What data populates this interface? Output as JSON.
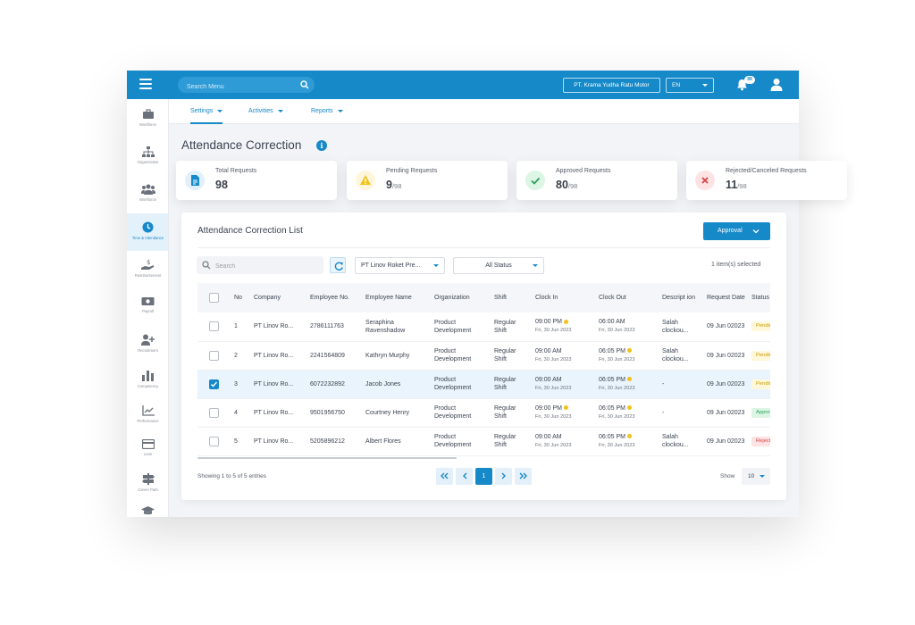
{
  "topbar": {
    "search_placeholder": "Search Menu",
    "company": "PT. Krama Yudha Ratu Motor",
    "language": "EN",
    "notification_count": "99"
  },
  "sidebar": {
    "items": [
      {
        "label": "Workforce",
        "icon": "briefcase-icon"
      },
      {
        "label": "Organization",
        "icon": "org-chart-icon"
      },
      {
        "label": "Workforce",
        "icon": "people-icon"
      },
      {
        "label": "Time & Attendance",
        "icon": "clock-icon"
      },
      {
        "label": "Reimbursement",
        "icon": "hand-dollar-icon"
      },
      {
        "label": "Payroll",
        "icon": "money-icon"
      },
      {
        "label": "Recruitment",
        "icon": "add-user-icon"
      },
      {
        "label": "Competency",
        "icon": "bar-chart-icon"
      },
      {
        "label": "Performance",
        "icon": "trend-chart-icon"
      },
      {
        "label": "Loan",
        "icon": "card-icon"
      },
      {
        "label": "Career Path",
        "icon": "signpost-icon"
      },
      {
        "label": "",
        "icon": "graduation-cap-icon"
      }
    ]
  },
  "subnav": {
    "settings": "Settings",
    "activities": "Activities",
    "reports": "Reports"
  },
  "page": {
    "title": "Attendance Correction"
  },
  "cards": {
    "total": {
      "title": "Total Requests",
      "value": "98"
    },
    "pending": {
      "title": "Pending Requests",
      "value": "9",
      "total": "/98"
    },
    "approved": {
      "title": "Approved Requests",
      "value": "80",
      "total": "/98"
    },
    "rejected": {
      "title": "Rejected/Canceled Requests",
      "value": "11",
      "total": "/98"
    }
  },
  "list": {
    "title": "Attendance Correction List",
    "approval_button": "Approval",
    "search_placeholder": "Search",
    "company_filter": "PT Linov Roket Pre...",
    "status_filter": "All Status",
    "selected_text": "1 item(s) selected"
  },
  "table": {
    "headers": {
      "no": "No",
      "company": "Company",
      "employee_no": "Employee No.",
      "employee_name": "Employee Name",
      "organization": "Organization",
      "shift": "Shift",
      "clock_in": "Clock In",
      "clock_out": "Clock Out",
      "description": "Descript ion",
      "request_date": "Request Date",
      "status": "Status"
    },
    "rows": [
      {
        "no": "1",
        "company": "PT Linov Ro...",
        "employee_no": "2786111763",
        "name": "Seraphina Ravenshadow",
        "org": "Product Development",
        "shift": "Regular Shift",
        "in_time": "09:00 PM",
        "in_date": "Fri, 30 Jun 2023",
        "out_time": "06:00 AM",
        "out_date": "Fri, 30 Jun 2023",
        "desc": "Salah clockou...",
        "req_date": "09 Jun 02023",
        "status": "Pending",
        "checked": false
      },
      {
        "no": "2",
        "company": "PT Linov Ro...",
        "employee_no": "2241564809",
        "name": "Kathryn Murphy",
        "org": "Product Development",
        "shift": "Regular Shift",
        "in_time": "09:00 AM",
        "in_date": "Fri, 30 Jun 2023",
        "out_time": "06:05 PM",
        "out_date": "Fri, 30 Jun 2023",
        "desc": "Salah clockou...",
        "req_date": "09 Jun 02023",
        "status": "Pending",
        "checked": false
      },
      {
        "no": "3",
        "company": "PT Linov Ro...",
        "employee_no": "6072232892",
        "name": "Jacob Jones",
        "org": "Product Development",
        "shift": "Regular Shift",
        "in_time": "09:00 AM",
        "in_date": "Fri, 30 Jun 2023",
        "out_time": "06:05 PM",
        "out_date": "Fri, 30 Jun 2023",
        "desc": "-",
        "req_date": "09 Jun 02023",
        "status": "Pending",
        "checked": true
      },
      {
        "no": "4",
        "company": "PT Linov Ro...",
        "employee_no": "9501956750",
        "name": "Courtney Henry",
        "org": "Product Development",
        "shift": "Regular Shift",
        "in_time": "09:00 PM",
        "in_date": "Fri, 30 Jun 2023",
        "out_time": "06:05 PM",
        "out_date": "Fri, 30 Jun 2023",
        "desc": "-",
        "req_date": "09 Jun 02023",
        "status": "Approved",
        "checked": false
      },
      {
        "no": "5",
        "company": "PT Linov Ro...",
        "employee_no": "5205896212",
        "name": "Albert Flores",
        "org": "Product Development",
        "shift": "Regular Shift",
        "in_time": "09:00 AM",
        "in_date": "Fri, 30 Jun 2023",
        "out_time": "06:05 PM",
        "out_date": "Fri, 30 Jun 2023",
        "desc": "Salah clockou...",
        "req_date": "09 Jun 02023",
        "status": "Rejected",
        "checked": false
      }
    ]
  },
  "footer": {
    "showing": "Showing 1 to 5 of 5 entries",
    "current_page": "1",
    "show_label": "Show",
    "page_size": "10"
  },
  "colors": {
    "primary": "#1689c9",
    "pending": "#f2c21b",
    "approved": "#2f9e5b",
    "rejected": "#d64545"
  }
}
